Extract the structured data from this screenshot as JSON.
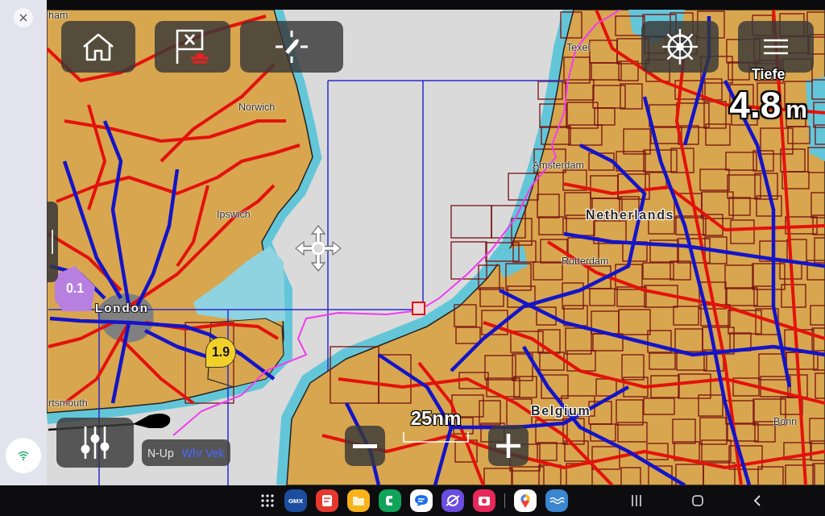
{
  "chart": {
    "place_labels": [
      {
        "text": "ham",
        "kind": "town"
      },
      {
        "text": "Texel",
        "kind": "town"
      },
      {
        "text": "Norwich",
        "kind": "town"
      },
      {
        "text": "Amsterdam",
        "kind": "town"
      },
      {
        "text": "Netherlands",
        "kind": "country"
      },
      {
        "text": "Ipswich",
        "kind": "town"
      },
      {
        "text": "Rotterdam",
        "kind": "town"
      },
      {
        "text": "London",
        "kind": "city"
      },
      {
        "text": "rtsmouth",
        "kind": "town"
      },
      {
        "text": "Belgium",
        "kind": "country"
      },
      {
        "text": "Bonn",
        "kind": "town"
      }
    ],
    "soundings": [
      {
        "value": "0.1",
        "kind": "area"
      },
      {
        "value": "1.9",
        "kind": "pin"
      }
    ]
  },
  "depth": {
    "label": "Tiefe",
    "value": "4.8",
    "unit": "m"
  },
  "orientation": {
    "mode": "N-Up",
    "motion": "Whr Vek"
  },
  "scale": {
    "label": "25nm"
  },
  "taskbar": {
    "apps": [
      {
        "label": "GMX"
      }
    ]
  }
}
